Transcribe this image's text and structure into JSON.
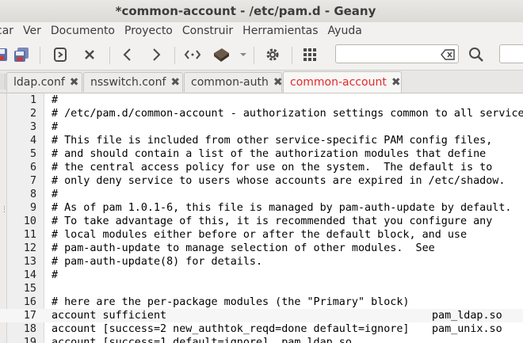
{
  "window": {
    "title": "*common-account - /etc/pam.d - Geany"
  },
  "menu": [
    "car",
    "Ver",
    "Documento",
    "Proyecto",
    "Construir",
    "Herramientas",
    "Ayuda"
  ],
  "toolbar": {
    "buttons": [
      {
        "name": "save-icon"
      },
      {
        "name": "save-all-icon"
      },
      {
        "name": "revert-icon"
      },
      {
        "name": "close-icon"
      },
      {
        "name": "back-icon"
      },
      {
        "name": "forward-icon"
      },
      {
        "name": "compile-icon"
      },
      {
        "name": "build-icon"
      },
      {
        "name": "settings-icon"
      },
      {
        "name": "color-chooser-icon"
      }
    ],
    "search_value": "",
    "colors": {
      "toolbar_bg": "#f2f1f0"
    }
  },
  "tabs": [
    {
      "label": "ldap.conf",
      "active": false
    },
    {
      "label": "nsswitch.conf",
      "active": false
    },
    {
      "label": "common-auth",
      "active": false
    },
    {
      "label": "common-account",
      "active": true
    }
  ],
  "active_tab_color": "#e32a2a",
  "editor": {
    "lines": [
      {
        "n": "1",
        "text": "#"
      },
      {
        "n": "2",
        "text": "# /etc/pam.d/common-account - authorization settings common to all services"
      },
      {
        "n": "3",
        "text": "#"
      },
      {
        "n": "4",
        "text": "# This file is included from other service-specific PAM config files,"
      },
      {
        "n": "5",
        "text": "# and should contain a list of the authorization modules that define"
      },
      {
        "n": "6",
        "text": "# the central access policy for use on the system.  The default is to"
      },
      {
        "n": "7",
        "text": "# only deny service to users whose accounts are expired in /etc/shadow."
      },
      {
        "n": "8",
        "text": "#"
      },
      {
        "n": "9",
        "text": "# As of pam 1.0.1-6, this file is managed by pam-auth-update by default."
      },
      {
        "n": "10",
        "text": "# To take advantage of this, it is recommended that you configure any"
      },
      {
        "n": "11",
        "text": "# local modules either before or after the default block, and use"
      },
      {
        "n": "12",
        "text": "# pam-auth-update to manage selection of other modules.  See"
      },
      {
        "n": "13",
        "text": "# pam-auth-update(8) for details."
      },
      {
        "n": "14",
        "text": "#"
      },
      {
        "n": "15",
        "text": ""
      },
      {
        "n": "16",
        "text": "# here are the per-package modules (the \"Primary\" block)"
      },
      {
        "n": "17",
        "text": "account sufficient",
        "rhs": "pam_ldap.so"
      },
      {
        "n": "18",
        "text": "account [success=2 new_authtok_reqd=done default=ignore]",
        "rhs": "pam_unix.so"
      },
      {
        "n": "19",
        "text": "account [success=1 default=ignore]  pam_ldap.so"
      }
    ]
  }
}
